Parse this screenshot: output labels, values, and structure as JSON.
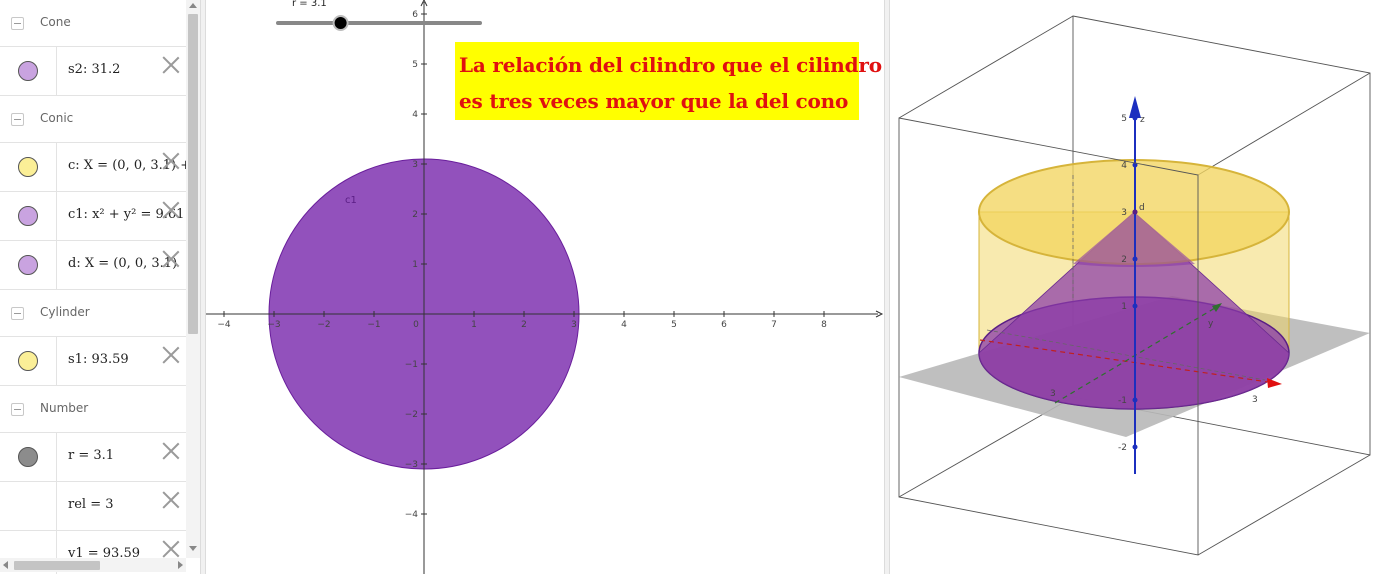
{
  "algebra": {
    "groups": [
      {
        "category": "Cone",
        "items": [
          {
            "text": "s2: 31.2",
            "color": "#c9a3e0"
          }
        ]
      },
      {
        "category": "Conic",
        "items": [
          {
            "text": "c: X = (0, 0, 3.1) +",
            "color": "#fbef97"
          },
          {
            "text": "c1: x² + y² = 9.61",
            "color": "#c9a3e0"
          },
          {
            "text": "d: X = (0, 0, 3.1)",
            "color": "#c9a3e0"
          }
        ]
      },
      {
        "category": "Cylinder",
        "items": [
          {
            "text": "s1: 93.59",
            "color": "#fbef97"
          }
        ]
      },
      {
        "category": "Number",
        "items": [
          {
            "text": "r = 3.1",
            "color": "#8c8c8c"
          },
          {
            "text": "rel = 3",
            "color": null
          },
          {
            "text": "v1 = 93.59",
            "color": null
          }
        ]
      }
    ]
  },
  "graphics": {
    "slider_label": "r = 3.1",
    "slider_value": 3.1,
    "slider_min": 0,
    "slider_max": 10,
    "circle_label": "c1",
    "circle_radius": 3.1,
    "circle_color": "#7a2bad",
    "x_ticks": [
      "−4",
      "−3",
      "−2",
      "−1",
      "0",
      "1",
      "2",
      "3",
      "4",
      "5",
      "6",
      "7",
      "8"
    ],
    "y_ticks": [
      "6",
      "5",
      "4",
      "3",
      "2",
      "1",
      "−1",
      "−2",
      "−3",
      "−4"
    ],
    "note_lines": [
      "La relación del cilindro que el cilindro",
      "es tres veces mayor que la del cono"
    ],
    "note_bg": "#ffff00",
    "note_color": "#e01010"
  },
  "view3d": {
    "z_label": "z",
    "y_label": "y",
    "z_ticks": [
      "5",
      "4",
      "3",
      "2",
      "1",
      "-1",
      "-2"
    ],
    "x_tick": "3",
    "y_tick": "3",
    "point_label": "d",
    "cylinder_color": "#f2d560",
    "cone_color": "#8a3aa8",
    "plane_color": "#b8b8b8",
    "axis_color": "#1c2fbf"
  }
}
